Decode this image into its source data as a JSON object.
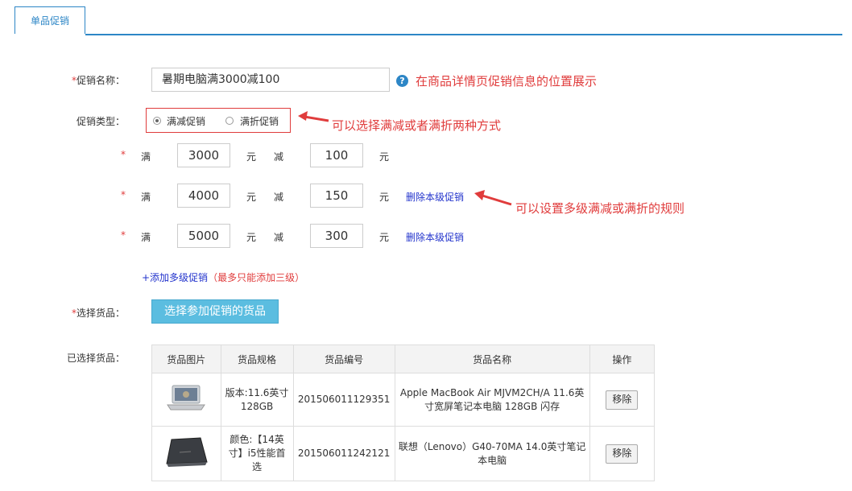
{
  "tab": {
    "label": "单品促销"
  },
  "form": {
    "name_label": "促销名称：",
    "name_value": "暑期电脑满3000减100",
    "name_hint": "在商品详情页促销信息的位置展示",
    "type_label": "促销类型：",
    "type_option_1": "满减促销",
    "type_option_2": "满折促销",
    "type_selected": "满减促销",
    "type_hint": "可以选择满减或者满折两种方式",
    "tiers": [
      {
        "prefix": "满",
        "amount": "3000",
        "unit1": "元",
        "mid": "减",
        "discount": "100",
        "unit2": "元"
      },
      {
        "prefix": "满",
        "amount": "4000",
        "unit1": "元",
        "mid": "减",
        "discount": "150",
        "unit2": "元",
        "delete": "删除本级促销"
      },
      {
        "prefix": "满",
        "amount": "5000",
        "unit1": "元",
        "mid": "减",
        "discount": "300",
        "unit2": "元",
        "delete": "删除本级促销"
      }
    ],
    "tier_hint": "可以设置多级满减或满折的规则",
    "add_tier": "+添加多级促销",
    "add_tier_note": "（最多只能添加三级）",
    "goods_label": "选择货品：",
    "goods_button": "选择参加促销的货品",
    "selected_label": "已选择货品："
  },
  "table": {
    "headers": [
      "货品图片",
      "货品规格",
      "货品编号",
      "货品名称",
      "操作"
    ],
    "rows": [
      {
        "spec": "版本:11.6英寸128GB",
        "code": "201506011129351",
        "name": "Apple MacBook Air MJVM2CH/A 11.6英寸宽屏笔记本电脑 128GB 闪存",
        "action": "移除"
      },
      {
        "spec": "颜色:【14英寸】i5性能首选",
        "code": "201506011242121",
        "name": "联想（Lenovo）G40-70MA 14.0英寸笔记本电脑",
        "action": "移除"
      }
    ]
  },
  "colors": {
    "accent": "#2d86c6",
    "required": "#e03c3c",
    "button": "#5bbde0",
    "link": "#2233cc"
  }
}
